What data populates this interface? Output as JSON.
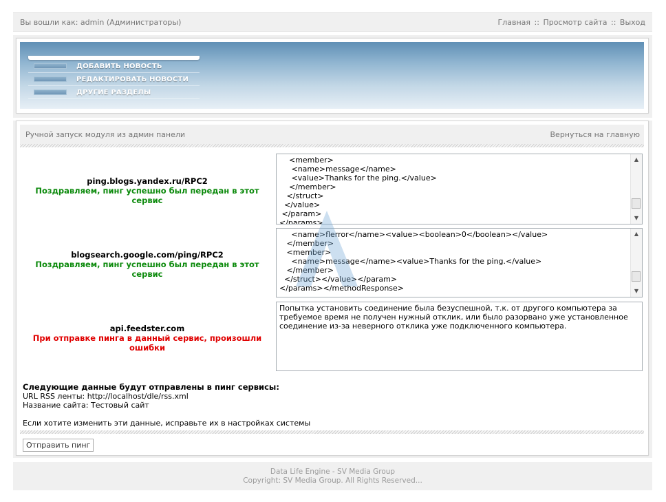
{
  "topbar": {
    "login_text": "Вы вошли как: admin (Администраторы)",
    "link_home": "Главная",
    "link_view_site": "Просмотр сайта",
    "link_logout": "Выход",
    "separator": "::"
  },
  "menu": {
    "items": [
      {
        "label": "ДОБАВИТЬ НОВОСТЬ"
      },
      {
        "label": "РЕДАКТИРОВАТЬ НОВОСТИ"
      },
      {
        "label": "ДРУГИЕ РАЗДЕЛЫ"
      }
    ]
  },
  "main": {
    "title": "Ручной запуск модуля из админ панели",
    "back_link": "Вернуться на главную",
    "services": [
      {
        "name": "ping.blogs.yandex.ru/RPC2",
        "status": "Поздравляем, пинг успешно был передан в этот сервис",
        "status_type": "ok",
        "response": "    <member>\n     <name>message</name>\n     <value>Thanks for the ping.</value>\n    </member>\n   </struct>\n  </value>\n </param>\n</params>"
      },
      {
        "name": "blogsearch.google.com/ping/RPC2",
        "status": "Поздравляем, пинг успешно был передан в этот сервис",
        "status_type": "ok",
        "response": "     <name>flerror</name><value><boolean>0</boolean></value>\n   </member>\n   <member>\n     <name>message</name><value>Thanks for the ping.</value>\n   </member>\n  </struct></value></param>\n</params></methodResponse>"
      },
      {
        "name": "api.feedster.com",
        "status": "При отправке пинга в данный сервис, произошли ошибки",
        "status_type": "error",
        "response": "Попытка установить соединение была безуспешной, т.к. от другого компьютера за требуемое время не получен нужный отклик, или было разорвано уже установленное соединение из-за неверного отклика уже подключенного компьютера."
      }
    ],
    "info": {
      "heading": "Следующие данные будут отправлены в пинг сервисы:",
      "rss_line": "URL RSS ленты: http://localhost/dle/rss.xml",
      "site_line": "Название сайта: Тестовый сайт",
      "note": "Если хотите изменить эти данные, исправьте их в настройках системы"
    },
    "submit_label": "Отправить пинг"
  },
  "footer": {
    "line1": "Data Life Engine - SV Media Group",
    "line2": "Copyright: SV Media Group. All Rights Reserved..."
  },
  "colors": {
    "ok": "#0c8a0c",
    "error": "#e00000",
    "muted": "#757575"
  }
}
